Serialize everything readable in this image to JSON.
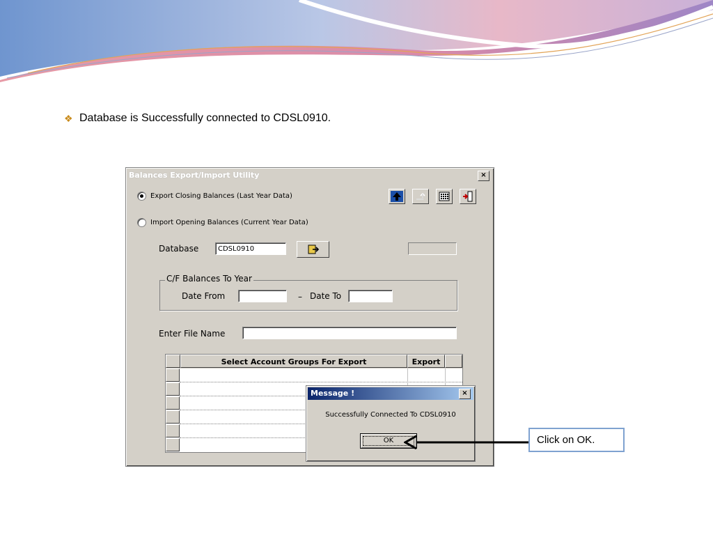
{
  "bullet": {
    "text": "Database is Successfully connected to CDSL0910.",
    "icon": "diamond-bullet-icon"
  },
  "window": {
    "title": "Balances Export/Import Utility",
    "close_label": "×",
    "export_radio_label": "Export Closing Balances (Last Year Data)",
    "import_radio_label": "Import Opening Balances (Current Year Data)",
    "database_label": "Database",
    "database_value": "CDSL0910",
    "group_legend": "C/F Balances To Year",
    "date_from_label": "Date From",
    "date_dash": "–",
    "date_to_label": "Date To",
    "date_from_value": "",
    "date_to_value": "",
    "file_name_label": "Enter File Name",
    "file_name_value": "",
    "grid": {
      "columns": [
        "Select Account Groups For Export",
        "Export"
      ],
      "rows": 6
    }
  },
  "message": {
    "title": "Message !",
    "close_label": "×",
    "text": "Successfully Connected To CDSL0910",
    "ok_label": "OK"
  },
  "callout": {
    "text": "Click on OK."
  },
  "colors": {
    "title_bar": "#0a246a",
    "accent_pink": "#d9809a",
    "accent_blue": "#6a8cc8",
    "callout_border": "#7fa2d0"
  }
}
